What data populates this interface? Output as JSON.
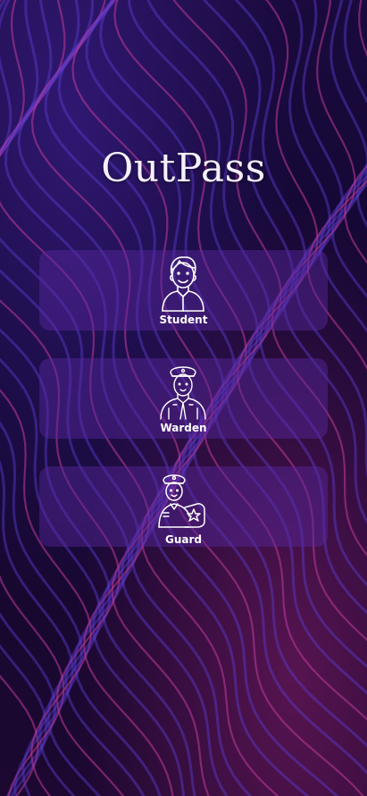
{
  "app": {
    "title": "OutPass"
  },
  "roles": [
    {
      "label": "Student",
      "icon": "student-icon"
    },
    {
      "label": "Warden",
      "icon": "warden-icon"
    },
    {
      "label": "Guard",
      "icon": "guard-icon"
    }
  ],
  "colors": {
    "card": "#5828a0",
    "text": "#ffffff",
    "background": "#0b0620"
  }
}
